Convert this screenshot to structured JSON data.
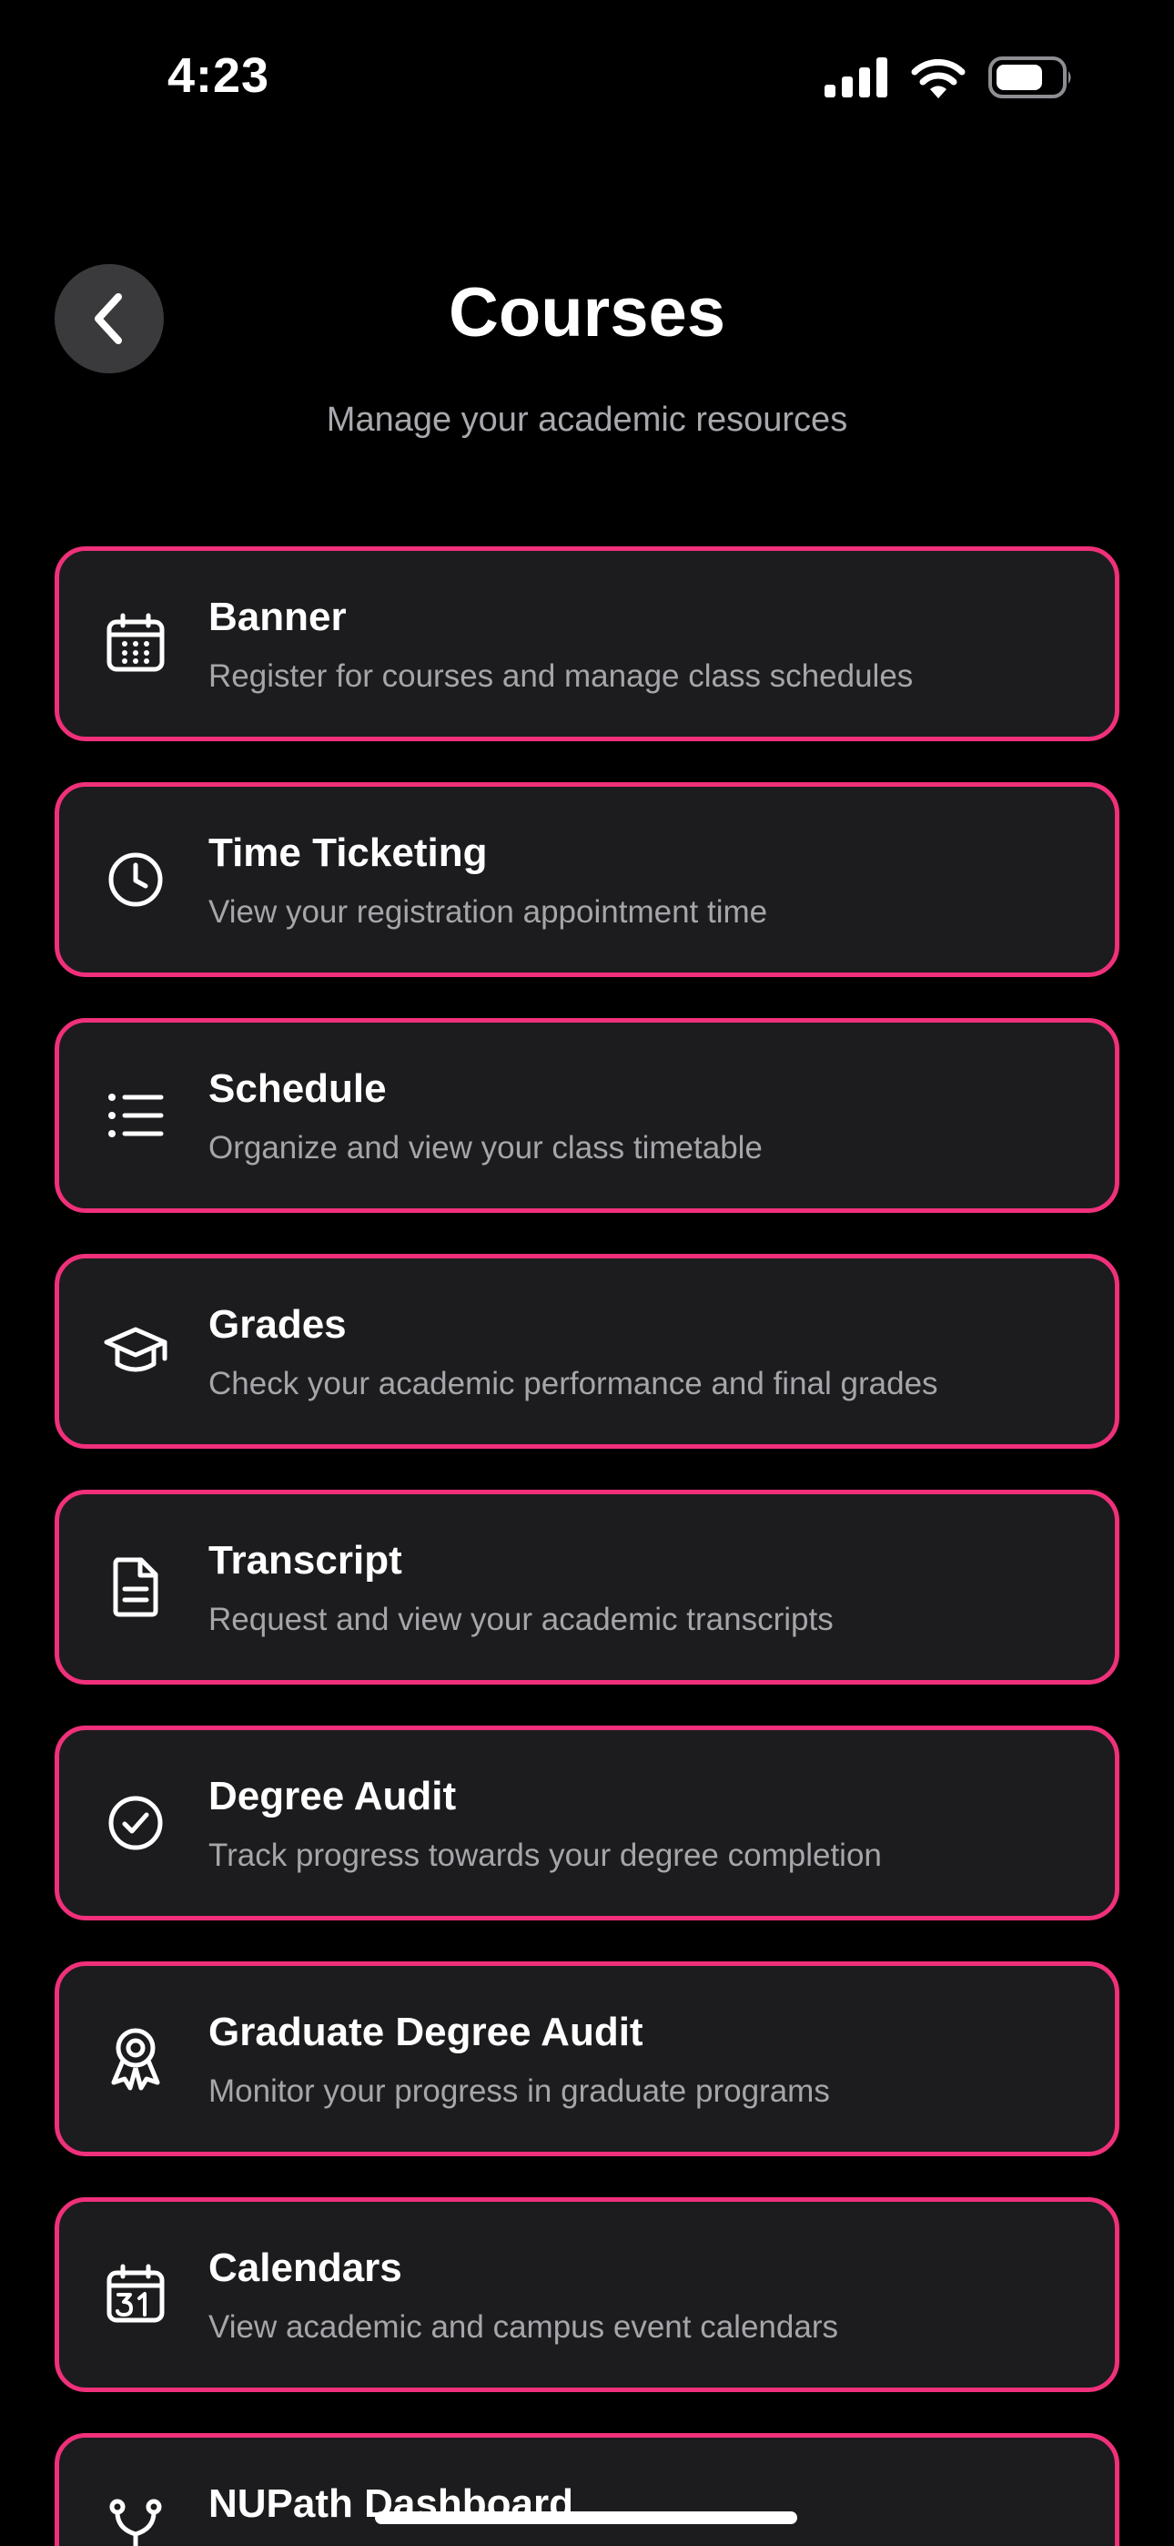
{
  "status_bar": {
    "time": "4:23"
  },
  "header": {
    "title": "Courses",
    "subtitle": "Manage your academic resources",
    "back_icon": "chevron-left-icon"
  },
  "accent_color": "#f0307a",
  "cards": [
    {
      "title": "Banner",
      "description": "Register for courses and manage class schedules",
      "icon": "calendar-grid-icon"
    },
    {
      "title": "Time Ticketing",
      "description": "View your registration appointment time",
      "icon": "clock-icon"
    },
    {
      "title": "Schedule",
      "description": "Organize and view your class timetable",
      "icon": "list-icon"
    },
    {
      "title": "Grades",
      "description": "Check your academic performance and final grades",
      "icon": "graduation-cap-icon"
    },
    {
      "title": "Transcript",
      "description": "Request and view your academic transcripts",
      "icon": "document-icon"
    },
    {
      "title": "Degree Audit",
      "description": "Track progress towards your degree completion",
      "icon": "check-circle-icon"
    },
    {
      "title": "Graduate Degree Audit",
      "description": "Monitor your progress in graduate programs",
      "icon": "award-ribbon-icon"
    },
    {
      "title": "Calendars",
      "description": "View academic and campus event calendars",
      "icon": "calendar-31-icon"
    },
    {
      "title": "NUPath Dashboard",
      "description": "",
      "icon": "branch-icon"
    }
  ]
}
